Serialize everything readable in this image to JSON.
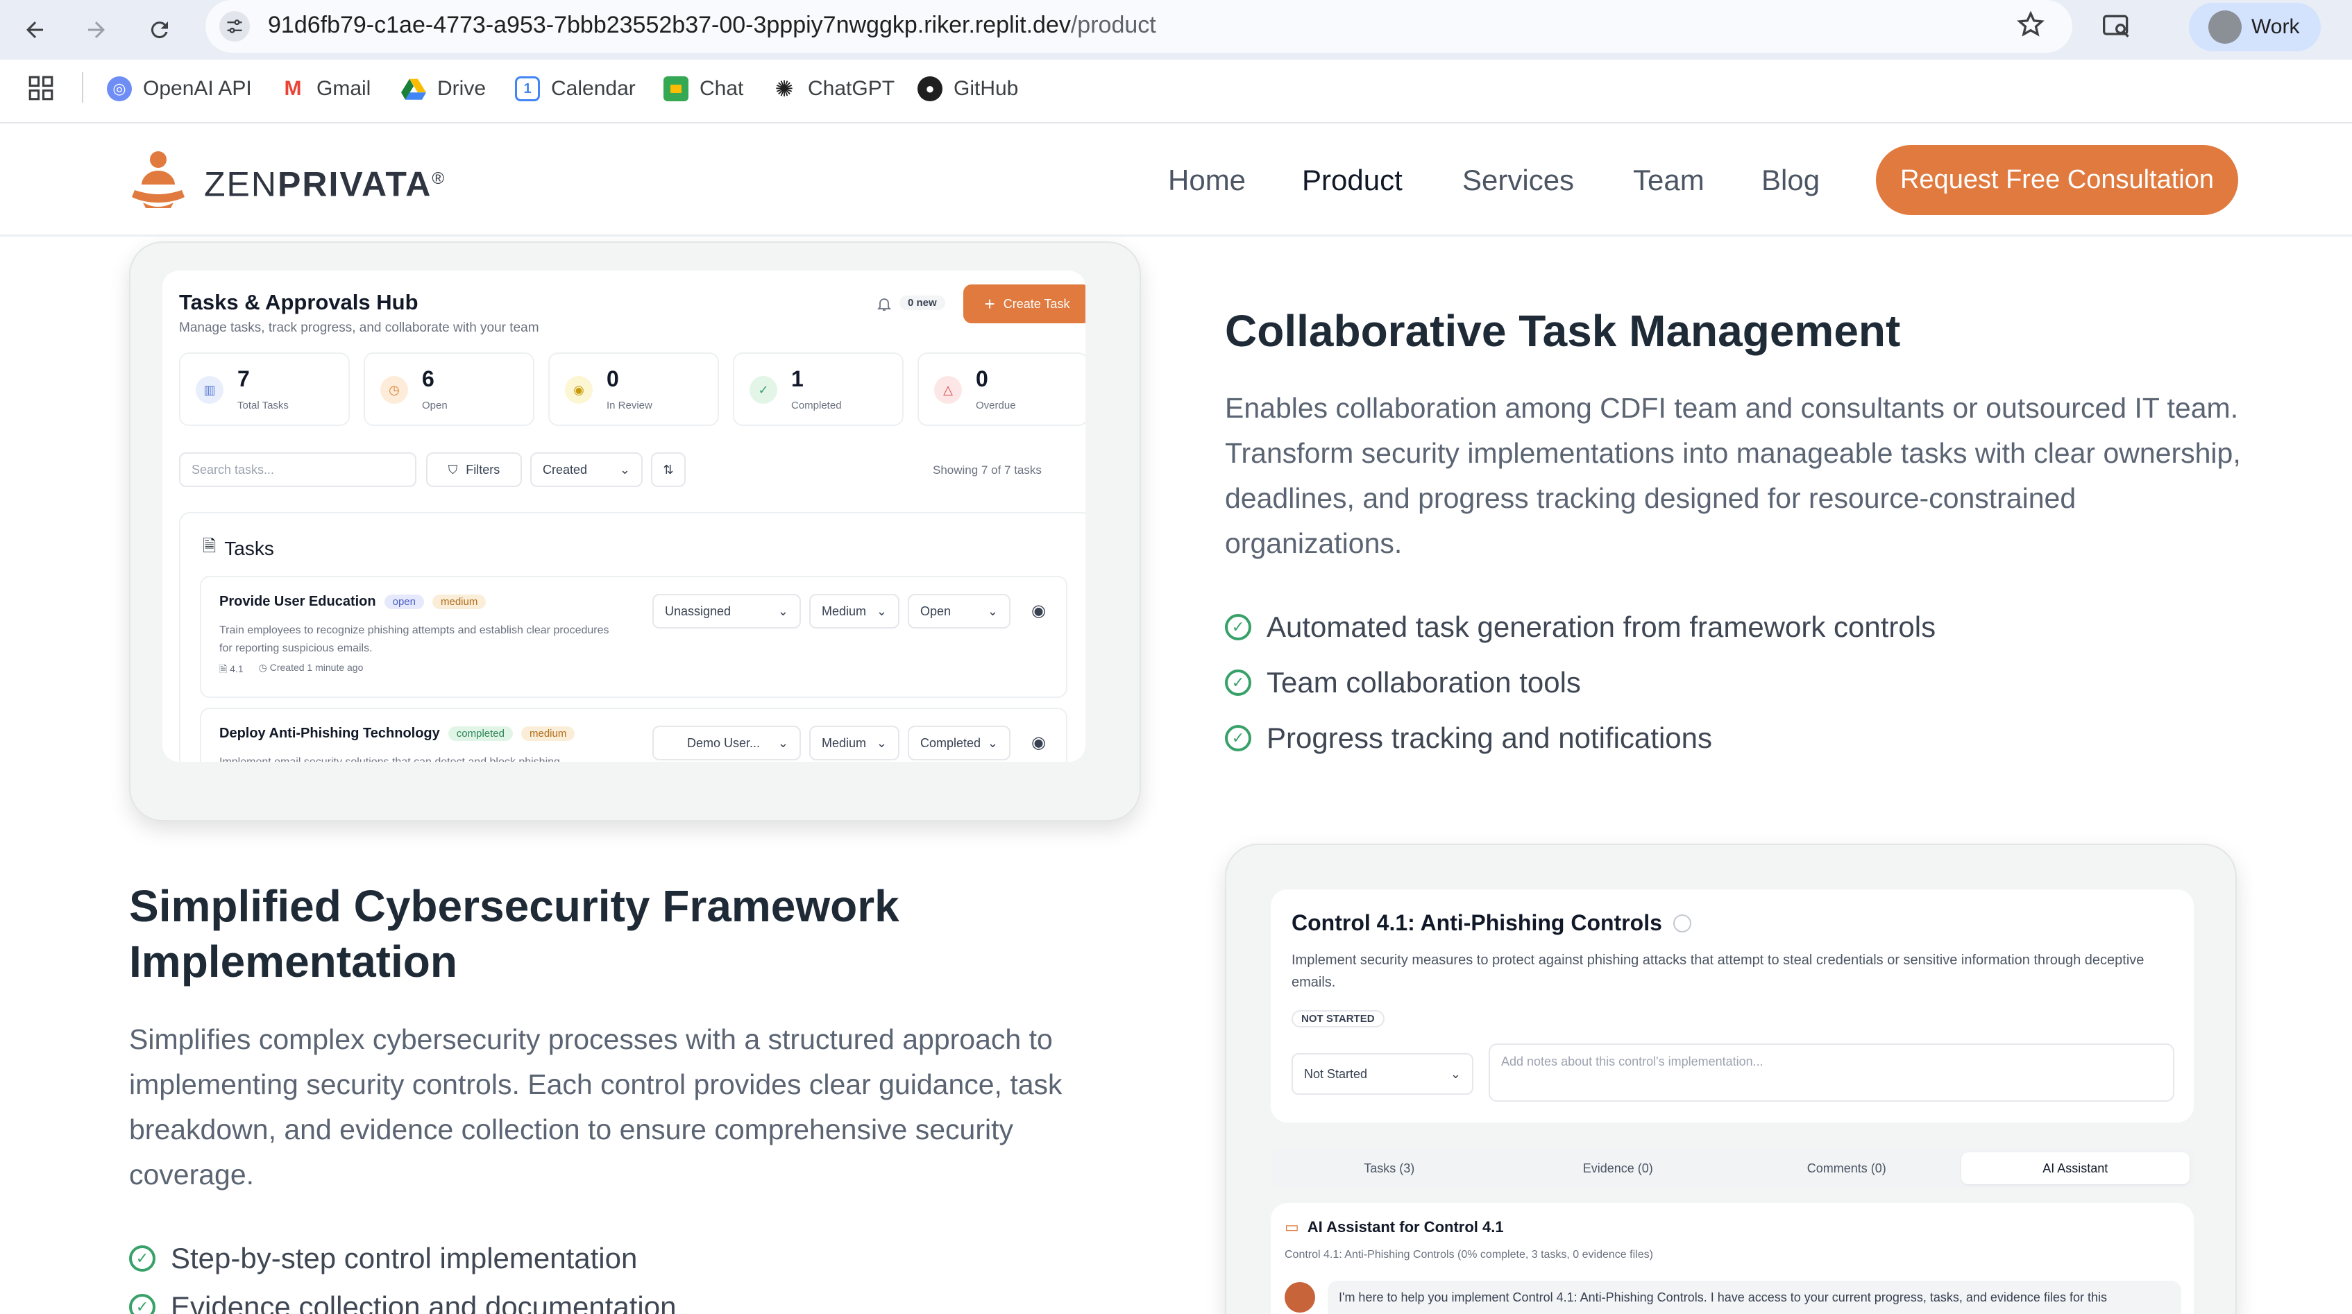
{
  "browser": {
    "url_host": "91d6fb79-c1ae-4773-a953-7bbb23552b37-00-3pppiy7nwggkp.riker.replit.dev",
    "url_path": "/product",
    "profile_label": "Work",
    "bookmarks": [
      {
        "label": "OpenAI API",
        "icon": "openai-icon"
      },
      {
        "label": "Gmail",
        "icon": "gmail-icon"
      },
      {
        "label": "Drive",
        "icon": "drive-icon"
      },
      {
        "label": "Calendar",
        "icon": "calendar-icon"
      },
      {
        "label": "Chat",
        "icon": "chat-icon"
      },
      {
        "label": "ChatGPT",
        "icon": "chatgpt-icon"
      },
      {
        "label": "GitHub",
        "icon": "github-icon"
      }
    ]
  },
  "site": {
    "logo_light": "ZEN",
    "logo_bold": "PRIVATA",
    "logo_mark": "®",
    "nav": [
      "Home",
      "Product",
      "Services",
      "Team",
      "Blog"
    ],
    "active_nav": "Product",
    "cta": "Request Free Consultation",
    "accent": "#e07a3f"
  },
  "tasks_mock": {
    "title": "Tasks & Approvals Hub",
    "subtitle": "Manage tasks, track progress, and collaborate with your team",
    "new_badge": "0 new",
    "create_button": "Create Task",
    "stats": [
      {
        "num": "7",
        "label": "Total Tasks"
      },
      {
        "num": "6",
        "label": "Open"
      },
      {
        "num": "0",
        "label": "In Review"
      },
      {
        "num": "1",
        "label": "Completed"
      },
      {
        "num": "0",
        "label": "Overdue"
      }
    ],
    "search_placeholder": "Search tasks...",
    "filters_label": "Filters",
    "sort_label": "Created",
    "showing": "Showing 7 of 7 tasks",
    "list_title": "Tasks",
    "tasks": [
      {
        "title": "Provide User Education",
        "status": "open",
        "priority": "medium",
        "desc": "Train employees to recognize phishing attempts and establish clear procedures for reporting suspicious emails.",
        "control": "4.1",
        "created": "Created 1 minute ago",
        "assignee": "Unassigned",
        "priority_select": "Medium",
        "status_select": "Open"
      },
      {
        "title": "Deploy Anti-Phishing Technology",
        "status": "completed",
        "priority": "medium",
        "desc": "Implement email security solutions that can detect and block phishing",
        "assignee": "Demo User...",
        "priority_select": "Medium",
        "status_select": "Completed"
      }
    ]
  },
  "section1": {
    "heading": "Collaborative Task Management",
    "body": "Enables collaboration among CDFI team and consultants or outsourced IT team. Transform security implementations into manageable tasks with clear ownership, deadlines, and progress tracking designed for resource-constrained organizations.",
    "features": [
      "Automated task generation from framework controls",
      "Team collaboration tools",
      "Progress tracking and notifications"
    ]
  },
  "section2": {
    "heading": "Simplified Cybersecurity Framework Implementation",
    "body": "Simplifies complex cybersecurity processes with a structured approach to implementing security controls. Each control provides clear guidance, task breakdown, and evidence collection to ensure comprehensive security coverage.",
    "features": [
      "Step-by-step control implementation",
      "Evidence collection and documentation"
    ]
  },
  "control_mock": {
    "title": "Control 4.1: Anti-Phishing Controls",
    "desc": "Implement security measures to protect against phishing attacks that attempt to steal credentials or sensitive information through deceptive emails.",
    "status_badge": "NOT STARTED",
    "status_select": "Not Started",
    "notes_placeholder": "Add notes about this control's implementation...",
    "tabs": [
      "Tasks (3)",
      "Evidence (0)",
      "Comments (0)",
      "AI Assistant"
    ],
    "active_tab": "AI Assistant",
    "ai_title": "AI Assistant for Control 4.1",
    "ai_sub": "Control 4.1: Anti-Phishing Controls (0% complete, 3 tasks, 0 evidence files)",
    "ai_message": "I'm here to help you implement Control 4.1: Anti-Phishing Controls. I have access to your current progress, tasks, and evidence files for this"
  }
}
